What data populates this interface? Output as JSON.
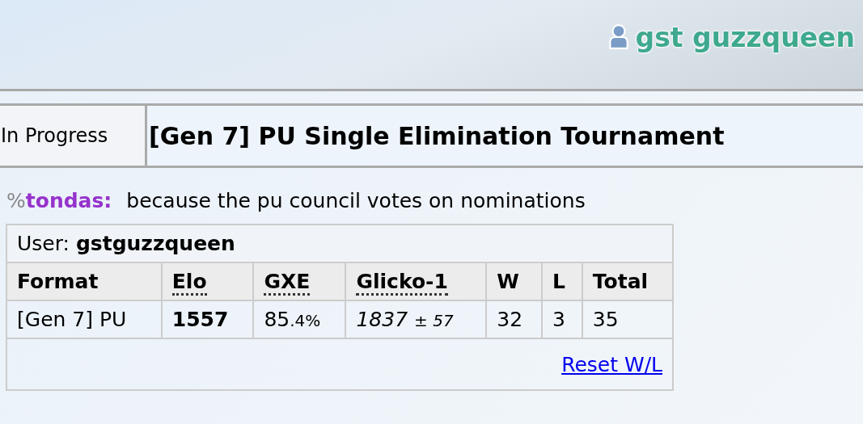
{
  "header": {
    "username": "gst guzzqueen"
  },
  "tournament": {
    "status": "In Progress",
    "title": "[Gen 7] PU Single Elimination Tournament"
  },
  "chat": [
    {
      "rank": "%",
      "user": "tondas:",
      "message": "because the pu council votes on nominations"
    }
  ],
  "ladder": {
    "user_label": "User:",
    "user": "gstguzzqueen",
    "columns": [
      {
        "label": "Format",
        "dotted": false
      },
      {
        "label": "Elo",
        "dotted": true
      },
      {
        "label": "GXE",
        "dotted": true
      },
      {
        "label": "Glicko-1",
        "dotted": true
      },
      {
        "label": "W",
        "dotted": false
      },
      {
        "label": "L",
        "dotted": false
      },
      {
        "label": "Total",
        "dotted": false
      }
    ],
    "rows": [
      {
        "format": "[Gen 7] PU",
        "elo": "1557",
        "gxe_whole": "85",
        "gxe_fraction": ".4%",
        "glicko": "1837",
        "glicko_sign": "±",
        "glicko_deviation": "57",
        "w": "32",
        "l": "3",
        "total": "35"
      }
    ],
    "reset_link": "Reset W/L"
  }
}
